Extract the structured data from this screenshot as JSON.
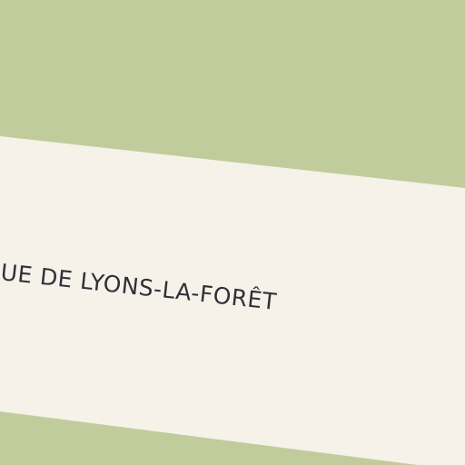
{
  "map": {
    "colors": {
      "forest": "#c1cc9c",
      "road": "#f7f2e9",
      "label": "#2e3138"
    },
    "road": {
      "label": "UE DE LYONS-LA-FORÊT"
    }
  }
}
